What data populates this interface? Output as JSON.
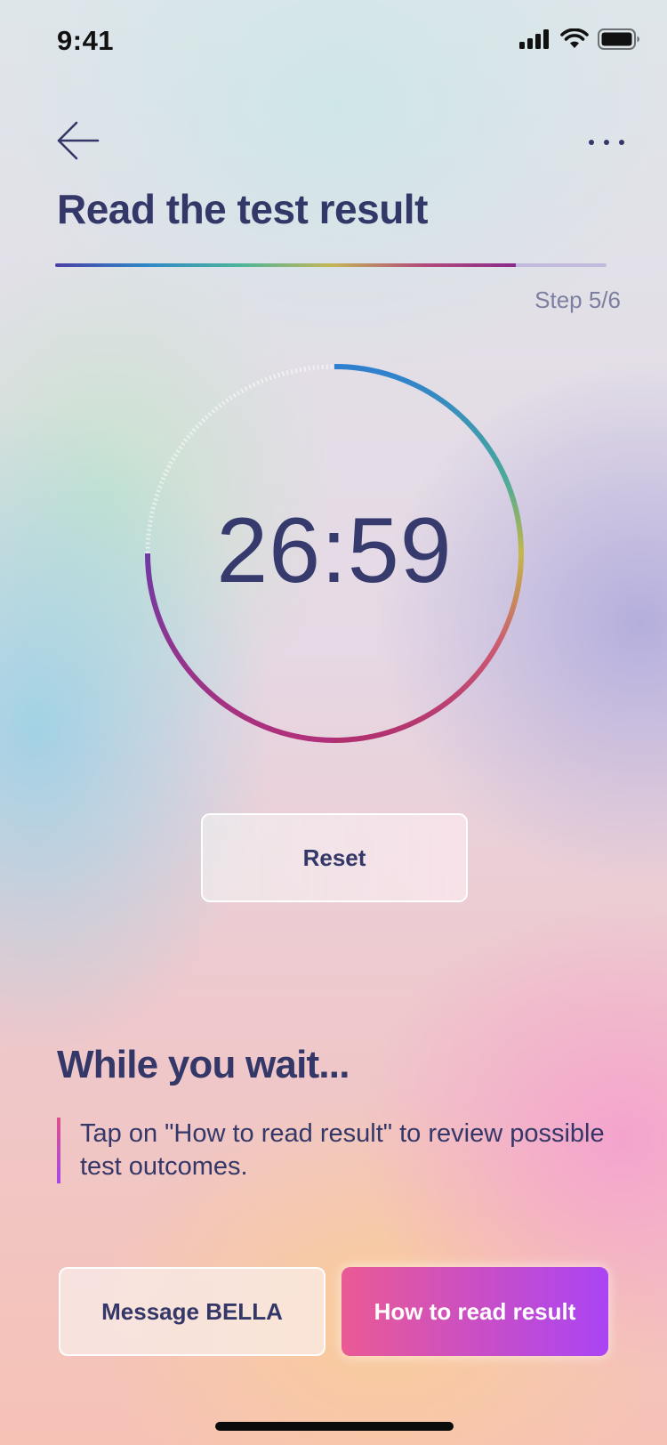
{
  "status_bar": {
    "time": "9:41"
  },
  "header": {
    "back_icon": "arrow-left-icon",
    "more_icon": "more-horizontal-icon",
    "title": "Read the test result"
  },
  "progress": {
    "fraction": 0.835,
    "step_label": "Step 5/6"
  },
  "timer": {
    "display": "26:59",
    "remaining_fraction": 0.75
  },
  "reset_button": {
    "label": "Reset"
  },
  "wait_section": {
    "title": "While you wait...",
    "text": "Tap on \"How to read result\" to review possible test outcomes."
  },
  "actions": {
    "message_label": "Message BELLA",
    "howto_label": "How to read result"
  },
  "colors": {
    "text_primary": "#343868",
    "accent_pink": "#ea5a94",
    "accent_purple": "#aa44f4"
  }
}
